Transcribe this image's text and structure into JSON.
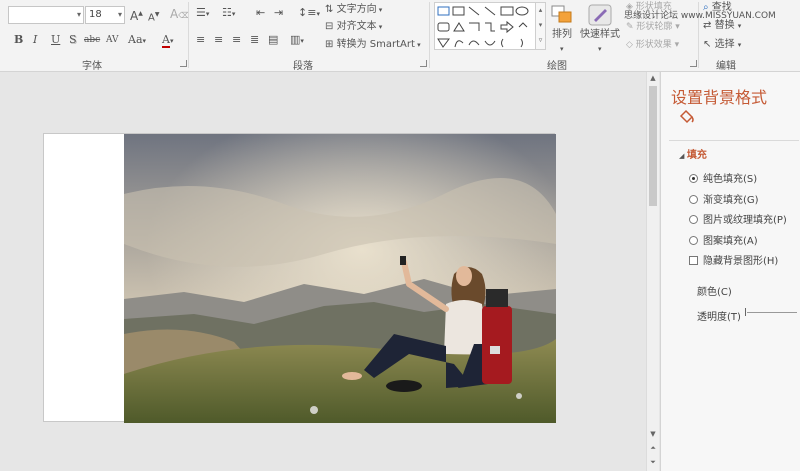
{
  "ribbon": {
    "font_group": {
      "label": "字体",
      "font_name_value": "",
      "font_size_value": "18",
      "grow_font": "A",
      "shrink_font": "A",
      "clear_format": "A",
      "bold": "B",
      "italic": "I",
      "underline": "U",
      "shadow": "S",
      "strikethrough": "abc",
      "spacing": "AV",
      "change_case": "Aa",
      "font_color": "A"
    },
    "paragraph_group": {
      "label": "段落",
      "text_direction": "文字方向",
      "align_text": "对齐文本",
      "convert_smartart": "转换为 SmartArt"
    },
    "drawing_group": {
      "label": "绘图",
      "arrange": "排列",
      "quick_styles": "快速样式",
      "shape_fill": "形状填充",
      "shape_outline": "形状轮廓",
      "shape_effects": "形状效果"
    },
    "editing_group": {
      "label": "编辑",
      "find": "查找",
      "replace": "替换",
      "select": "选择"
    }
  },
  "watermark": "思缘设计论坛 www.MISSYUAN.COM",
  "format_pane": {
    "title": "设置背景格式",
    "fill_section": "填充",
    "options": [
      {
        "label": "纯色填充(S)",
        "selected": true
      },
      {
        "label": "渐变填充(G)",
        "selected": false
      },
      {
        "label": "图片或纹理填充(P)",
        "selected": false
      },
      {
        "label": "图案填充(A)",
        "selected": false
      }
    ],
    "hide_bg_graphics": "隐藏背景图形(H)",
    "color_label": "颜色(C)",
    "transparency_label": "透明度(T)"
  },
  "colors": {
    "accent": "#c55a35",
    "ribbon_bg": "#f3f3f3",
    "workspace_bg": "#e6e6e6"
  }
}
